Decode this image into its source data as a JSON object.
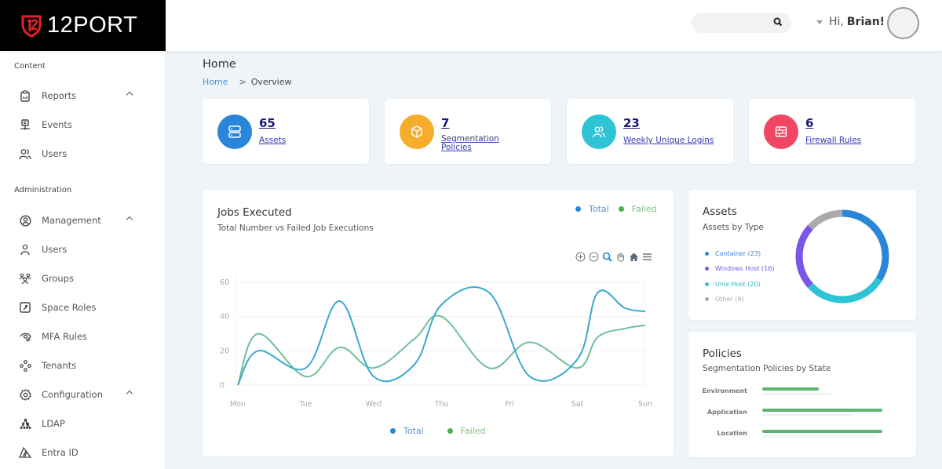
{
  "brand": {
    "name": "12PORT",
    "accent": "#e02424"
  },
  "topbar": {
    "search_placeholder": "",
    "greeting_prefix": "Hi,",
    "user_name": "Brian!"
  },
  "sidebar": {
    "sections": [
      {
        "label": "Content",
        "items": [
          {
            "label": "Reports",
            "icon": "clipboard-chart-icon",
            "expandable": true
          },
          {
            "label": "Events",
            "icon": "monitor-network-icon",
            "expandable": false
          },
          {
            "label": "Users",
            "icon": "users-icon",
            "expandable": false
          }
        ]
      },
      {
        "label": "Administration",
        "items": [
          {
            "label": "Management",
            "icon": "user-circle-icon",
            "expandable": true
          },
          {
            "label": "Users",
            "icon": "user-icon",
            "expandable": false
          },
          {
            "label": "Groups",
            "icon": "group-icon",
            "expandable": false
          },
          {
            "label": "Space Roles",
            "icon": "key-square-icon",
            "expandable": false
          },
          {
            "label": "MFA Rules",
            "icon": "eye-check-icon",
            "expandable": false
          },
          {
            "label": "Tenants",
            "icon": "tenants-icon",
            "expandable": false
          },
          {
            "label": "Configuration",
            "icon": "gear-icon",
            "expandable": true
          },
          {
            "label": "LDAP",
            "icon": "hierarchy-icon",
            "expandable": false
          },
          {
            "label": "Entra ID",
            "icon": "azure-icon",
            "expandable": false
          }
        ]
      }
    ]
  },
  "page": {
    "title": "Home",
    "breadcrumb": {
      "home": "Home",
      "separator": ">",
      "current": "Overview"
    }
  },
  "stats": [
    {
      "value": "65",
      "label": "Assets",
      "icon": "server-icon",
      "color": "#2a86d8"
    },
    {
      "value": "7",
      "label": "Segmentation Policies",
      "icon": "cube-icon",
      "color": "#f7ad2c"
    },
    {
      "value": "23",
      "label": "Weekly Unique Logins",
      "icon": "users-icon",
      "color": "#2ec4d6"
    },
    {
      "value": "6",
      "label": "Firewall Rules",
      "icon": "firewall-icon",
      "color": "#f04762"
    }
  ],
  "jobs_card": {
    "title": "Jobs Executed",
    "subtitle": "Total Number vs Failed Job Executions",
    "toolbar": [
      "zoom-in-icon",
      "zoom-out-icon",
      "zoom-select-icon",
      "pan-hand-icon",
      "home-reset-icon",
      "menu-icon"
    ]
  },
  "assets_card": {
    "title": "Assets",
    "subtitle": "Assets by Type"
  },
  "policies_card": {
    "title": "Policies",
    "subtitle": "Segmentation Policies by State"
  },
  "chart_data": [
    {
      "type": "line",
      "title": "Jobs Executed",
      "subtitle": "Total Number vs Failed Job Executions",
      "categories": [
        "Mon",
        "Tue",
        "Wed",
        "Thu",
        "Fri",
        "Sat",
        "Sun"
      ],
      "x_positions": [
        0,
        0.3,
        1,
        1.5,
        2,
        2.6,
        3,
        3.7,
        4.3,
        5,
        5.3,
        5.7,
        6
      ],
      "series": [
        {
          "name": "Total",
          "color": "#2a86d8",
          "line_color": "#3aa8cf",
          "values": [
            0,
            20,
            10,
            49,
            5,
            12,
            47,
            54,
            5,
            15,
            54,
            45,
            43
          ]
        },
        {
          "name": "Failed",
          "color": "#4caf50",
          "line_color": "#6fbf9a",
          "values": [
            0,
            30,
            5,
            22,
            10,
            27,
            40,
            10,
            25,
            10,
            28,
            33,
            35
          ]
        }
      ],
      "ylim": [
        0,
        60
      ],
      "yticks": [
        0,
        20,
        40,
        60
      ],
      "grid": true,
      "legend": [
        "top-right",
        "bottom-center"
      ],
      "xlabel": "",
      "ylabel": ""
    },
    {
      "type": "pie",
      "title": "Assets",
      "subtitle": "Assets by Type",
      "donut": true,
      "categories": [
        "Container",
        "Windows Host",
        "Unix Host",
        "Other"
      ],
      "values": [
        23,
        16,
        20,
        9
      ],
      "legend_labels": [
        "Container (23)",
        "Windows Host (16)",
        "Unix Host (20)",
        "Other (9)"
      ],
      "colors": [
        "#2a86d8",
        "#7a55e8",
        "#2ec4d6",
        "#aaaaaa"
      ],
      "slice_order_clockwise_from_top": [
        "Container",
        "Unix Host",
        "Windows Host",
        "Other"
      ],
      "legend": "left"
    },
    {
      "type": "bar",
      "orientation": "horizontal",
      "title": "Policies",
      "subtitle": "Segmentation Policies by State",
      "categories": [
        "Environment",
        "Application",
        "Location"
      ],
      "values_fraction": [
        0.47,
        1.0,
        1.0
      ],
      "color": "#5fb46f"
    }
  ]
}
